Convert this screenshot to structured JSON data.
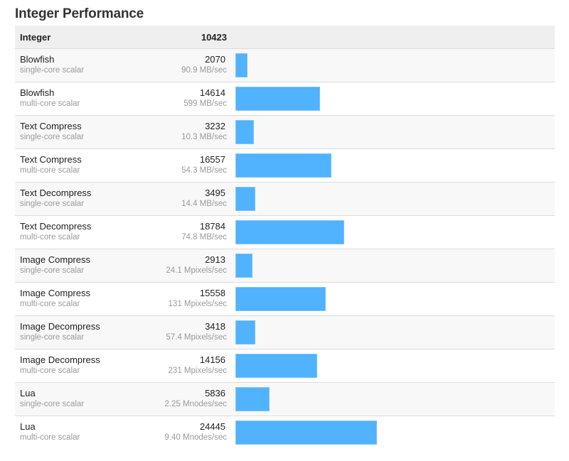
{
  "title": "Integer Performance",
  "header": {
    "name": "Integer",
    "score": "10423"
  },
  "colors": {
    "bar": "#51b2fe",
    "header_bg": "#efefef",
    "alt_row_bg": "#f8f8f8"
  },
  "chart_data": {
    "type": "bar",
    "orientation": "horizontal",
    "title": "Integer Performance",
    "summary": {
      "label": "Integer",
      "score": 10423
    },
    "xlim": [
      0,
      24445
    ],
    "rows": [
      {
        "name": "Blowfish",
        "mode": "single-core scalar",
        "score": 2070,
        "rate": "90.9 MB/sec"
      },
      {
        "name": "Blowfish",
        "mode": "multi-core scalar",
        "score": 14614,
        "rate": "599 MB/sec"
      },
      {
        "name": "Text Compress",
        "mode": "single-core scalar",
        "score": 3232,
        "rate": "10.3 MB/sec"
      },
      {
        "name": "Text Compress",
        "mode": "multi-core scalar",
        "score": 16557,
        "rate": "54.3 MB/sec"
      },
      {
        "name": "Text Decompress",
        "mode": "single-core scalar",
        "score": 3495,
        "rate": "14.4 MB/sec"
      },
      {
        "name": "Text Decompress",
        "mode": "multi-core scalar",
        "score": 18784,
        "rate": "74.8 MB/sec"
      },
      {
        "name": "Image Compress",
        "mode": "single-core scalar",
        "score": 2913,
        "rate": "24.1 Mpixels/sec"
      },
      {
        "name": "Image Compress",
        "mode": "multi-core scalar",
        "score": 15558,
        "rate": "131 Mpixels/sec"
      },
      {
        "name": "Image Decompress",
        "mode": "single-core scalar",
        "score": 3418,
        "rate": "57.4 Mpixels/sec"
      },
      {
        "name": "Image Decompress",
        "mode": "multi-core scalar",
        "score": 14156,
        "rate": "231 Mpixels/sec"
      },
      {
        "name": "Lua",
        "mode": "single-core scalar",
        "score": 5836,
        "rate": "2.25 Mnodes/sec"
      },
      {
        "name": "Lua",
        "mode": "multi-core scalar",
        "score": 24445,
        "rate": "9.40 Mnodes/sec"
      }
    ]
  }
}
